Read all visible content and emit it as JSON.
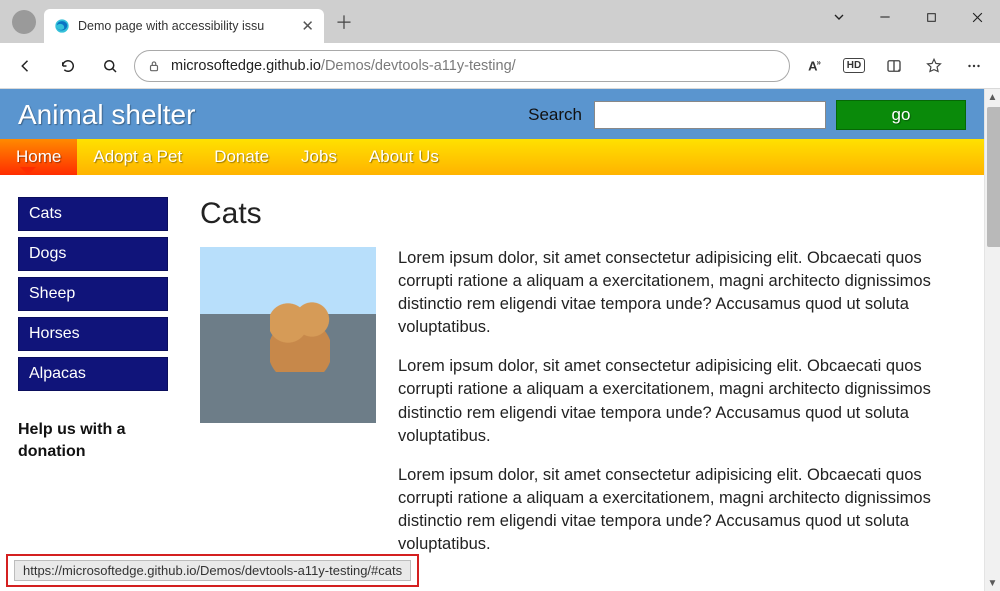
{
  "browser": {
    "tab_title": "Demo page with accessibility issu",
    "address_host": "microsoftedge.github.io",
    "address_path": "/Demos/devtools-a11y-testing/",
    "hd_label": "HD"
  },
  "page": {
    "site_title": "Animal shelter",
    "search_label": "Search",
    "go_label": "go",
    "nav": [
      {
        "label": "Home",
        "active": true
      },
      {
        "label": "Adopt a Pet",
        "active": false
      },
      {
        "label": "Donate",
        "active": false
      },
      {
        "label": "Jobs",
        "active": false
      },
      {
        "label": "About Us",
        "active": false
      }
    ],
    "sidebar": {
      "items": [
        {
          "label": "Cats"
        },
        {
          "label": "Dogs"
        },
        {
          "label": "Sheep"
        },
        {
          "label": "Horses"
        },
        {
          "label": "Alpacas"
        }
      ],
      "donation_heading": "Help us with a donation"
    },
    "main": {
      "heading": "Cats",
      "paragraph": "Lorem ipsum dolor, sit amet consectetur adipisicing elit. Obcaecati quos corrupti ratione a aliquam a exercitationem, magni architecto dignissimos distinctio rem eligendi vitae tempora unde? Accusamus quod ut soluta voluptatibus."
    }
  },
  "status_url": "https://microsoftedge.github.io/Demos/devtools-a11y-testing/#cats"
}
